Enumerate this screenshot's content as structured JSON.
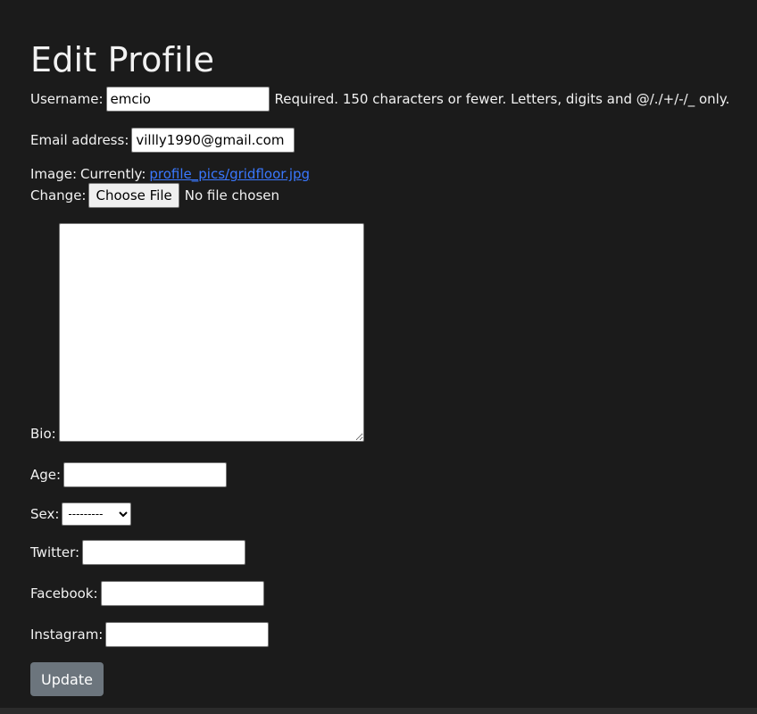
{
  "page": {
    "title": "Edit Profile"
  },
  "form": {
    "username": {
      "label": "Username:",
      "value": "emcio",
      "help": "Required. 150 characters or fewer. Letters, digits and @/./+/-/_ only."
    },
    "email": {
      "label": "Email address:",
      "value": "villly1990@gmail.com"
    },
    "image": {
      "label": "Image:",
      "currently_label": "Currently:",
      "current_file": "profile_pics/gridfloor.jpg",
      "change_label": "Change:",
      "choose_button": "Choose File",
      "no_file": "No file chosen"
    },
    "bio": {
      "label": "Bio:",
      "value": ""
    },
    "age": {
      "label": "Age:",
      "value": ""
    },
    "sex": {
      "label": "Sex:",
      "selected": "---------"
    },
    "twitter": {
      "label": "Twitter:",
      "value": ""
    },
    "facebook": {
      "label": "Facebook:",
      "value": ""
    },
    "instagram": {
      "label": "Instagram:",
      "value": ""
    },
    "submit": {
      "label": "Update"
    }
  },
  "colors": {
    "background": "#1b1b1b",
    "text": "#f2f2f2",
    "link": "#3a78ff",
    "button": "#6c757d"
  }
}
